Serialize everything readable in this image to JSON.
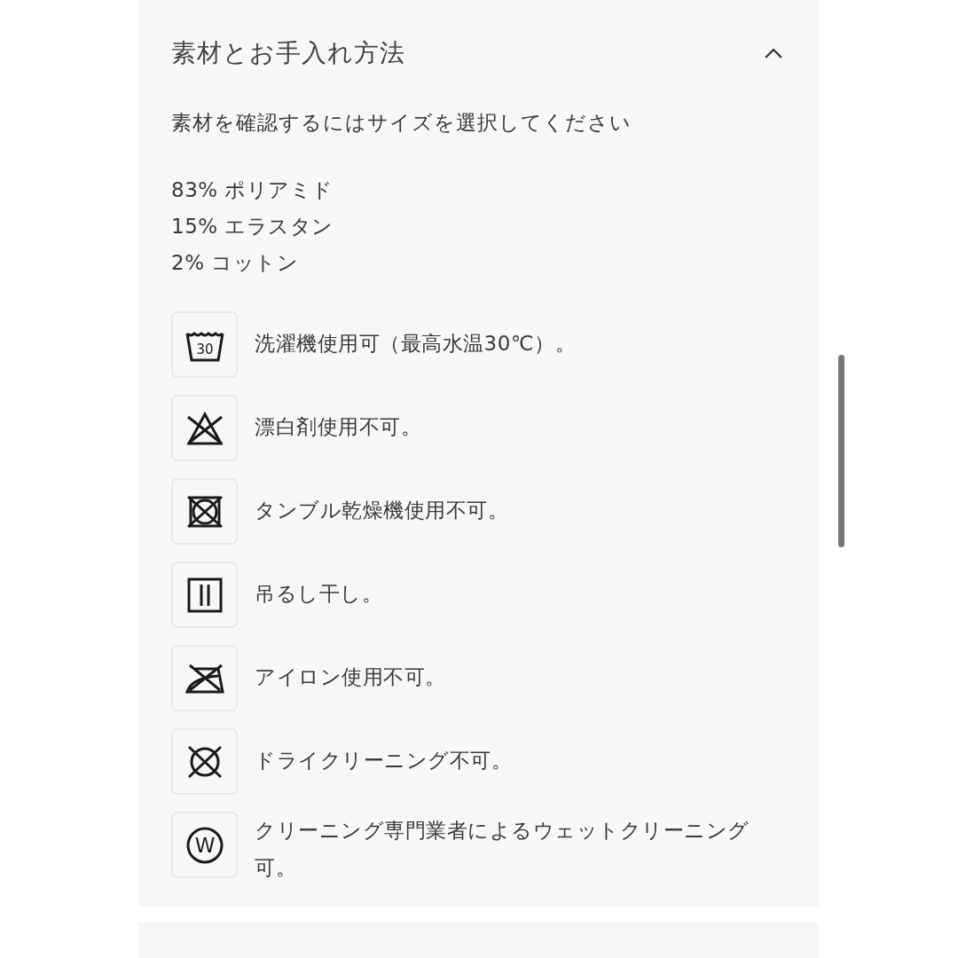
{
  "section": {
    "title": "素材とお手入れ方法",
    "expanded": true,
    "size_prompt": "素材を確認するにはサイズを選択してください",
    "composition": [
      "83% ポリアミド",
      "15% エラスタン",
      "2% コットン"
    ],
    "care": [
      {
        "kind": "wash",
        "label": "30",
        "text": "洗濯機使用可（最高水温30℃）。"
      },
      {
        "kind": "no-bleach",
        "text": "漂白剤使用不可。"
      },
      {
        "kind": "no-tumble-dry",
        "text": "タンブル乾燥機使用不可。"
      },
      {
        "kind": "line-dry",
        "text": "吊るし干し。"
      },
      {
        "kind": "no-iron",
        "text": "アイロン使用不可。"
      },
      {
        "kind": "no-dryclean",
        "text": "ドライクリーニング不可。"
      },
      {
        "kind": "wet-clean",
        "label": "W",
        "text": "クリーニング専門業者によるウェットクリーニング可。"
      }
    ]
  }
}
